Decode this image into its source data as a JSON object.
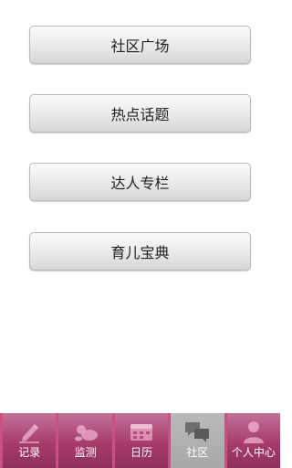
{
  "menu": {
    "items": [
      {
        "label": "社区广场"
      },
      {
        "label": "热点话题"
      },
      {
        "label": "达人专栏"
      },
      {
        "label": "育儿宝典"
      }
    ]
  },
  "tabbar": {
    "active_index": 3,
    "active_color": "#aaaaaa",
    "accent_color": "#c9517f",
    "tabs": [
      {
        "label": "记录",
        "icon": "pencil-icon"
      },
      {
        "label": "监测",
        "icon": "baby-icon"
      },
      {
        "label": "日历",
        "icon": "calendar-icon"
      },
      {
        "label": "社区",
        "icon": "chat-bubbles-icon"
      },
      {
        "label": "个人中心",
        "icon": "person-icon"
      }
    ]
  }
}
